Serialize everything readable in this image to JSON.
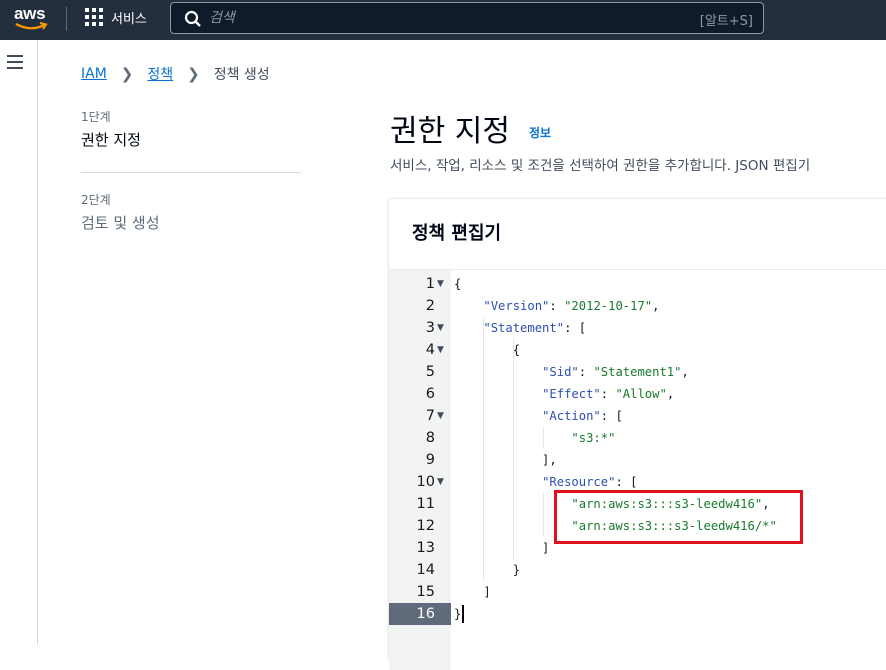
{
  "topnav": {
    "logo_text": "aws",
    "services_label": "서비스",
    "search_placeholder": "검색",
    "search_shortcut": "[알트+S]"
  },
  "breadcrumb": {
    "items": [
      "IAM",
      "정책",
      "정책 생성"
    ]
  },
  "steps": [
    {
      "number": "1단계",
      "title": "권한 지정",
      "active": true
    },
    {
      "number": "2단계",
      "title": "검토 및 생성",
      "active": false
    }
  ],
  "header": {
    "title": "권한 지정",
    "info_link": "정보",
    "description": "서비스, 작업, 리소스 및 조건을 선택하여 권한을 추가합니다. JSON 편집기"
  },
  "editor": {
    "title": "정책 편집기",
    "active_line": 16,
    "lines": [
      {
        "n": "1",
        "fold": true,
        "text": "{"
      },
      {
        "n": "2",
        "fold": false,
        "text": "    \"Version\": \"2012-10-17\","
      },
      {
        "n": "3",
        "fold": true,
        "text": "    \"Statement\": ["
      },
      {
        "n": "4",
        "fold": true,
        "text": "        {"
      },
      {
        "n": "5",
        "fold": false,
        "text": "            \"Sid\": \"Statement1\","
      },
      {
        "n": "6",
        "fold": false,
        "text": "            \"Effect\": \"Allow\","
      },
      {
        "n": "7",
        "fold": true,
        "text": "            \"Action\": ["
      },
      {
        "n": "8",
        "fold": false,
        "text": "                \"s3:*\""
      },
      {
        "n": "9",
        "fold": false,
        "text": "            ],"
      },
      {
        "n": "10",
        "fold": true,
        "text": "            \"Resource\": ["
      },
      {
        "n": "11",
        "fold": false,
        "text": "                \"arn:aws:s3:::s3-leedw416\","
      },
      {
        "n": "12",
        "fold": false,
        "text": "                \"arn:aws:s3:::s3-leedw416/*\""
      },
      {
        "n": "13",
        "fold": false,
        "text": "            ]"
      },
      {
        "n": "14",
        "fold": false,
        "text": "        }"
      },
      {
        "n": "15",
        "fold": false,
        "text": "    ]"
      },
      {
        "n": "16",
        "fold": false,
        "text": "}"
      }
    ]
  },
  "colors": {
    "nav_bg": "#232f3e",
    "link": "#0972d3",
    "highlight": "#e0111d",
    "json_key": "#2d4fb2",
    "json_string": "#1a7a2e"
  }
}
